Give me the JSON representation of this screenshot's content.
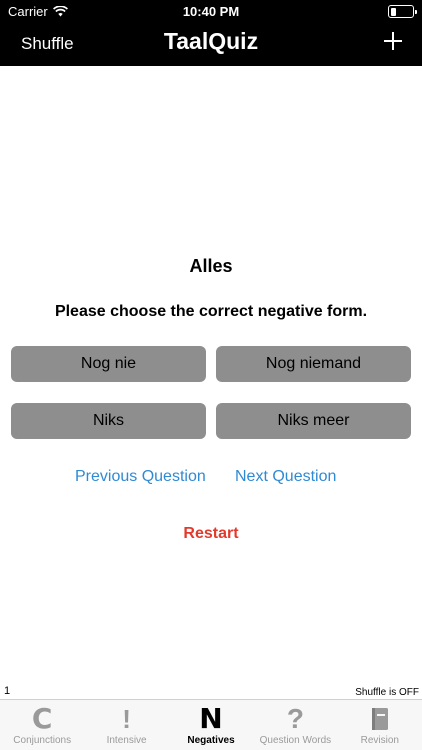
{
  "status_bar": {
    "carrier": "Carrier",
    "time": "10:40 PM",
    "battery_level": 0.25
  },
  "nav": {
    "left_label": "Shuffle",
    "title": "TaalQuiz",
    "right_icon": "plus-icon"
  },
  "quiz": {
    "word": "Alles",
    "prompt": "Please choose the correct negative form.",
    "options": [
      "Nog nie",
      "Nog niemand",
      "Niks",
      "Niks meer"
    ],
    "previous_label": "Previous Question",
    "next_label": "Next Question",
    "restart_label": "Restart",
    "counter": "1",
    "shuffle_state": "Shuffle is OFF"
  },
  "colors": {
    "link": "#2f8ad4",
    "restart": "#e23b2e",
    "option_bg": "#8e8e8e"
  },
  "tabs": [
    {
      "label": "Conjunctions",
      "icon": "c-icon",
      "glyph": "C",
      "active": false
    },
    {
      "label": "Intensive",
      "icon": "exclamation-icon",
      "glyph": "!",
      "active": false
    },
    {
      "label": "Negatives",
      "icon": "n-icon",
      "glyph": "N",
      "active": true
    },
    {
      "label": "Question Words",
      "icon": "question-icon",
      "glyph": "?",
      "active": false
    },
    {
      "label": "Revision",
      "icon": "book-icon",
      "glyph": "",
      "active": false
    }
  ]
}
